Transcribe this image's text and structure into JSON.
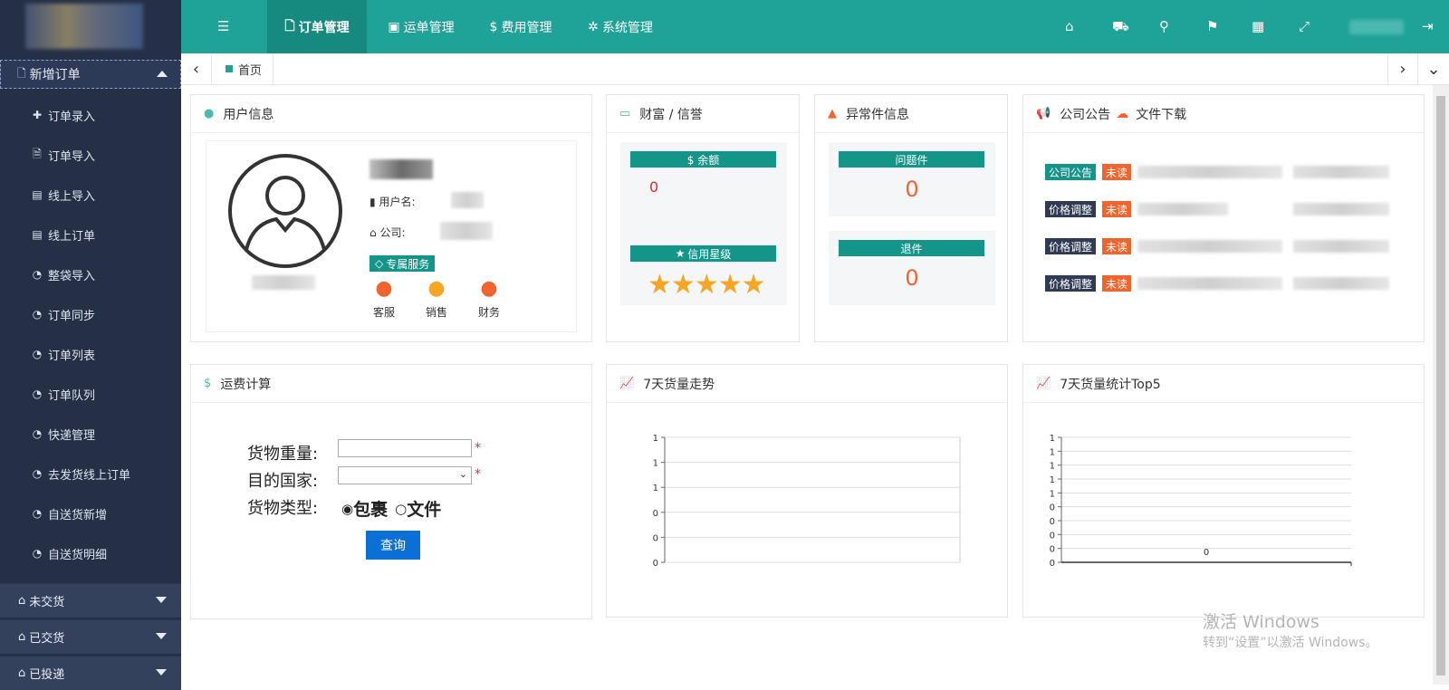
{
  "sidebar": {
    "group_label": "新增订单",
    "items": [
      {
        "icon": "plus-icon",
        "glyph": "✚",
        "label": "订单录入"
      },
      {
        "icon": "file-import-icon",
        "glyph": "🗎",
        "label": "订单导入"
      },
      {
        "icon": "file-icon",
        "glyph": "▤",
        "label": "线上导入"
      },
      {
        "icon": "file-icon",
        "glyph": "▤",
        "label": "线上订单"
      },
      {
        "icon": "dashboard-icon",
        "glyph": "◔",
        "label": "整袋导入"
      },
      {
        "icon": "dashboard-icon",
        "glyph": "◔",
        "label": "订单同步"
      },
      {
        "icon": "dashboard-icon",
        "glyph": "◔",
        "label": "订单列表"
      },
      {
        "icon": "dashboard-icon",
        "glyph": "◔",
        "label": "订单队列"
      },
      {
        "icon": "dashboard-icon",
        "glyph": "◔",
        "label": "快递管理"
      },
      {
        "icon": "dashboard-icon",
        "glyph": "◔",
        "label": "去发货线上订单"
      },
      {
        "icon": "dashboard-icon",
        "glyph": "◔",
        "label": "自送货新增"
      },
      {
        "icon": "dashboard-icon",
        "glyph": "◔",
        "label": "自送货明细"
      }
    ],
    "collapsed": [
      {
        "icon": "home-icon",
        "label": "未交货"
      },
      {
        "icon": "home-icon",
        "label": "已交货"
      },
      {
        "icon": "home-icon",
        "label": "已投递"
      }
    ]
  },
  "topbar": {
    "nav": [
      {
        "icon": "file-icon",
        "glyph": "🗋",
        "label": "订单管理",
        "active": true
      },
      {
        "icon": "address-card-icon",
        "glyph": "▣",
        "label": "运单管理",
        "active": false
      },
      {
        "icon": "dollar-icon",
        "glyph": "$",
        "label": "费用管理",
        "active": false
      },
      {
        "icon": "gear-icon",
        "glyph": "✲",
        "label": "系统管理",
        "active": false
      }
    ]
  },
  "tabbar": {
    "home_tab": "首页"
  },
  "user_panel": {
    "title": "用户信息",
    "username_label": "用户名:",
    "company_label": "公司:",
    "service_badge": "专属服务",
    "contacts": [
      "客服",
      "销售",
      "财务"
    ]
  },
  "wealth_panel": {
    "title": "财富 / 信誉",
    "balance_label": "$ 余额",
    "balance_value": "0",
    "credit_label": "信用星级",
    "stars": 5
  },
  "exception_panel": {
    "title": "异常件信息",
    "problem_label": "问题件",
    "problem_value": "0",
    "return_label": "退件",
    "return_value": "0"
  },
  "notice_panel": {
    "title": "公司公告",
    "download_title": "文件下载",
    "rows": [
      {
        "category": "公司公告",
        "status": "未读"
      },
      {
        "category": "价格调整",
        "status": "未读"
      },
      {
        "category": "价格调整",
        "status": "未读"
      },
      {
        "category": "价格调整",
        "status": "未读"
      }
    ]
  },
  "freight_panel": {
    "title": "运费计算",
    "weight_label": "货物重量:",
    "country_label": "目的国家:",
    "type_label": "货物类型:",
    "type_options": [
      "包裹",
      "文件"
    ],
    "selected_type": "包裹",
    "required_mark": "*",
    "query_button": "查询"
  },
  "trend_panel": {
    "title": "7天货量走势"
  },
  "top5_panel": {
    "title": "7天货量统计Top5"
  },
  "chart_data": [
    {
      "type": "line",
      "title": "7天货量走势",
      "y_ticks": [
        "0",
        "0",
        "0",
        "1",
        "1",
        "1"
      ],
      "series": []
    },
    {
      "type": "bar",
      "title": "7天货量统计Top5",
      "y_ticks": [
        "0",
        "0",
        "0",
        "0",
        "0",
        "1",
        "1",
        "1",
        "1",
        "1"
      ],
      "data_labels": [
        "0"
      ],
      "values": [
        0
      ]
    }
  ],
  "watermark": {
    "line1": "激活 Windows",
    "line2": "转到“设置”以激活 Windows。"
  },
  "colors": {
    "sidebar": "#253047",
    "topbar": "#1fa297",
    "accent": "#14958a",
    "unread": "#f0642e",
    "category": "#2f3b55",
    "button": "#0b6fd3",
    "star": "#f5a623"
  }
}
